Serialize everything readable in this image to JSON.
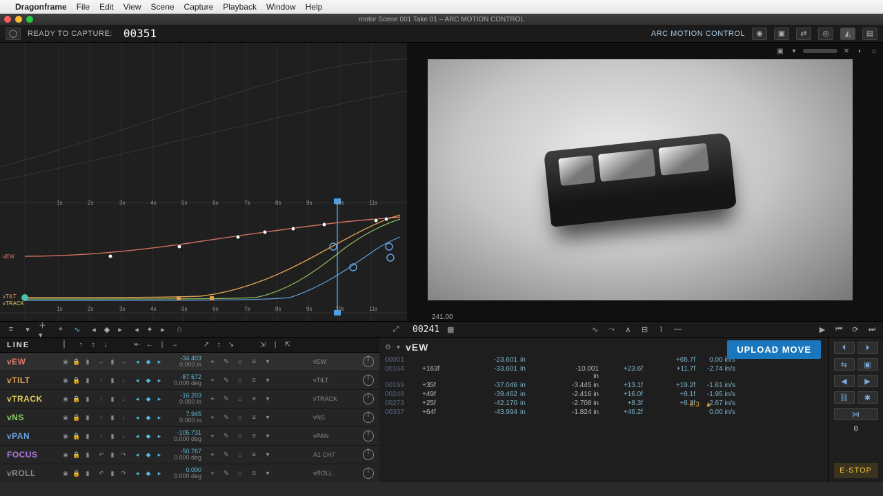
{
  "menubar": {
    "app": "Dragonframe",
    "items": [
      "File",
      "Edit",
      "View",
      "Scene",
      "Capture",
      "Playback",
      "Window",
      "Help"
    ]
  },
  "titlebar": "motor  Scene 001  Take 01 – ARC MOTION CONTROL",
  "toolbar": {
    "status": "READY TO CAPTURE:",
    "frame": "00351",
    "mode": "ARC MOTION CONTROL"
  },
  "ruler": [
    "1s",
    "2s",
    "3s",
    "4s",
    "5s",
    "6s",
    "7s",
    "8s",
    "9s",
    "10s",
    "11s"
  ],
  "axis_labels": {
    "vew": "vEW",
    "vtilt": "vTILT",
    "vtrack": "vTRACK"
  },
  "viewport": {
    "readout": "241.00"
  },
  "midbar": {
    "frame": "00241"
  },
  "axis_header": "LINE",
  "axes": [
    {
      "name": "vEW",
      "cls": "c-red",
      "sel": true,
      "v": "-34.403",
      "u": "0.000 in"
    },
    {
      "name": "vTILT",
      "cls": "c-org",
      "v": "-87.672",
      "u": "0.000 deg"
    },
    {
      "name": "vTRACK",
      "cls": "c-yel",
      "v": "-16.203",
      "u": "0.000 in"
    },
    {
      "name": "vNS",
      "cls": "c-grn",
      "v": "7.945",
      "u": "0.000 in"
    },
    {
      "name": "vPAN",
      "cls": "c-blu",
      "v": "-105.731",
      "u": "0.000 deg"
    },
    {
      "name": "FOCUS",
      "cls": "c-pur",
      "v": "-50.767",
      "u": "0.000 deg"
    },
    {
      "name": "vROLL",
      "cls": "c-gry",
      "v": "0.000",
      "u": "0.000 deg"
    }
  ],
  "miniaxes": [
    "vEW",
    "vTILT",
    "vTRACK",
    "vNS",
    "vPAN",
    "A1 CH7",
    "vROLL"
  ],
  "data_head": "vEW",
  "data_rows": [
    {
      "f": "00001",
      "df": "",
      "pos": "-23.601",
      "unit": "in",
      "ease": "",
      "e2": "",
      "tan": "+65.7f",
      "vel": "0.00 in/s"
    },
    {
      "f": "00164",
      "df": "+163f",
      "pos": "-33.601",
      "unit": "in",
      "ease": "-10.001 in",
      "e2": "+23.6f",
      "tan": "+11.7f",
      "vel": "-2.74 in/s"
    },
    {
      "f": "00199",
      "df": "+35f",
      "pos": "-37.046",
      "unit": "in",
      "ease": "-3.445 in",
      "e2": "+13.1f",
      "tan": "+19.2f",
      "vel": "-1.61 in/s"
    },
    {
      "f": "00248",
      "df": "+49f",
      "pos": "-39.462",
      "unit": "in",
      "ease": "-2.416 in",
      "e2": "+16.0f",
      "tan": "+8.1f",
      "vel": "-1.95 in/s"
    },
    {
      "f": "00273",
      "df": "+25f",
      "pos": "-42.170",
      "unit": "in",
      "ease": "-2.708 in",
      "e2": "+8.3f",
      "tan": "+8.2f",
      "vel": "-2.67 in/s"
    },
    {
      "f": "00337",
      "df": "+64f",
      "pos": "-43.994",
      "unit": "in",
      "ease": "-1.824 in",
      "e2": "+46.2f",
      "tan": "",
      "vel": "0.00 in/s",
      "warn": "8.3"
    }
  ],
  "upload": "UPLOAD MOVE",
  "estop": "E-STOP",
  "side_num": "0"
}
